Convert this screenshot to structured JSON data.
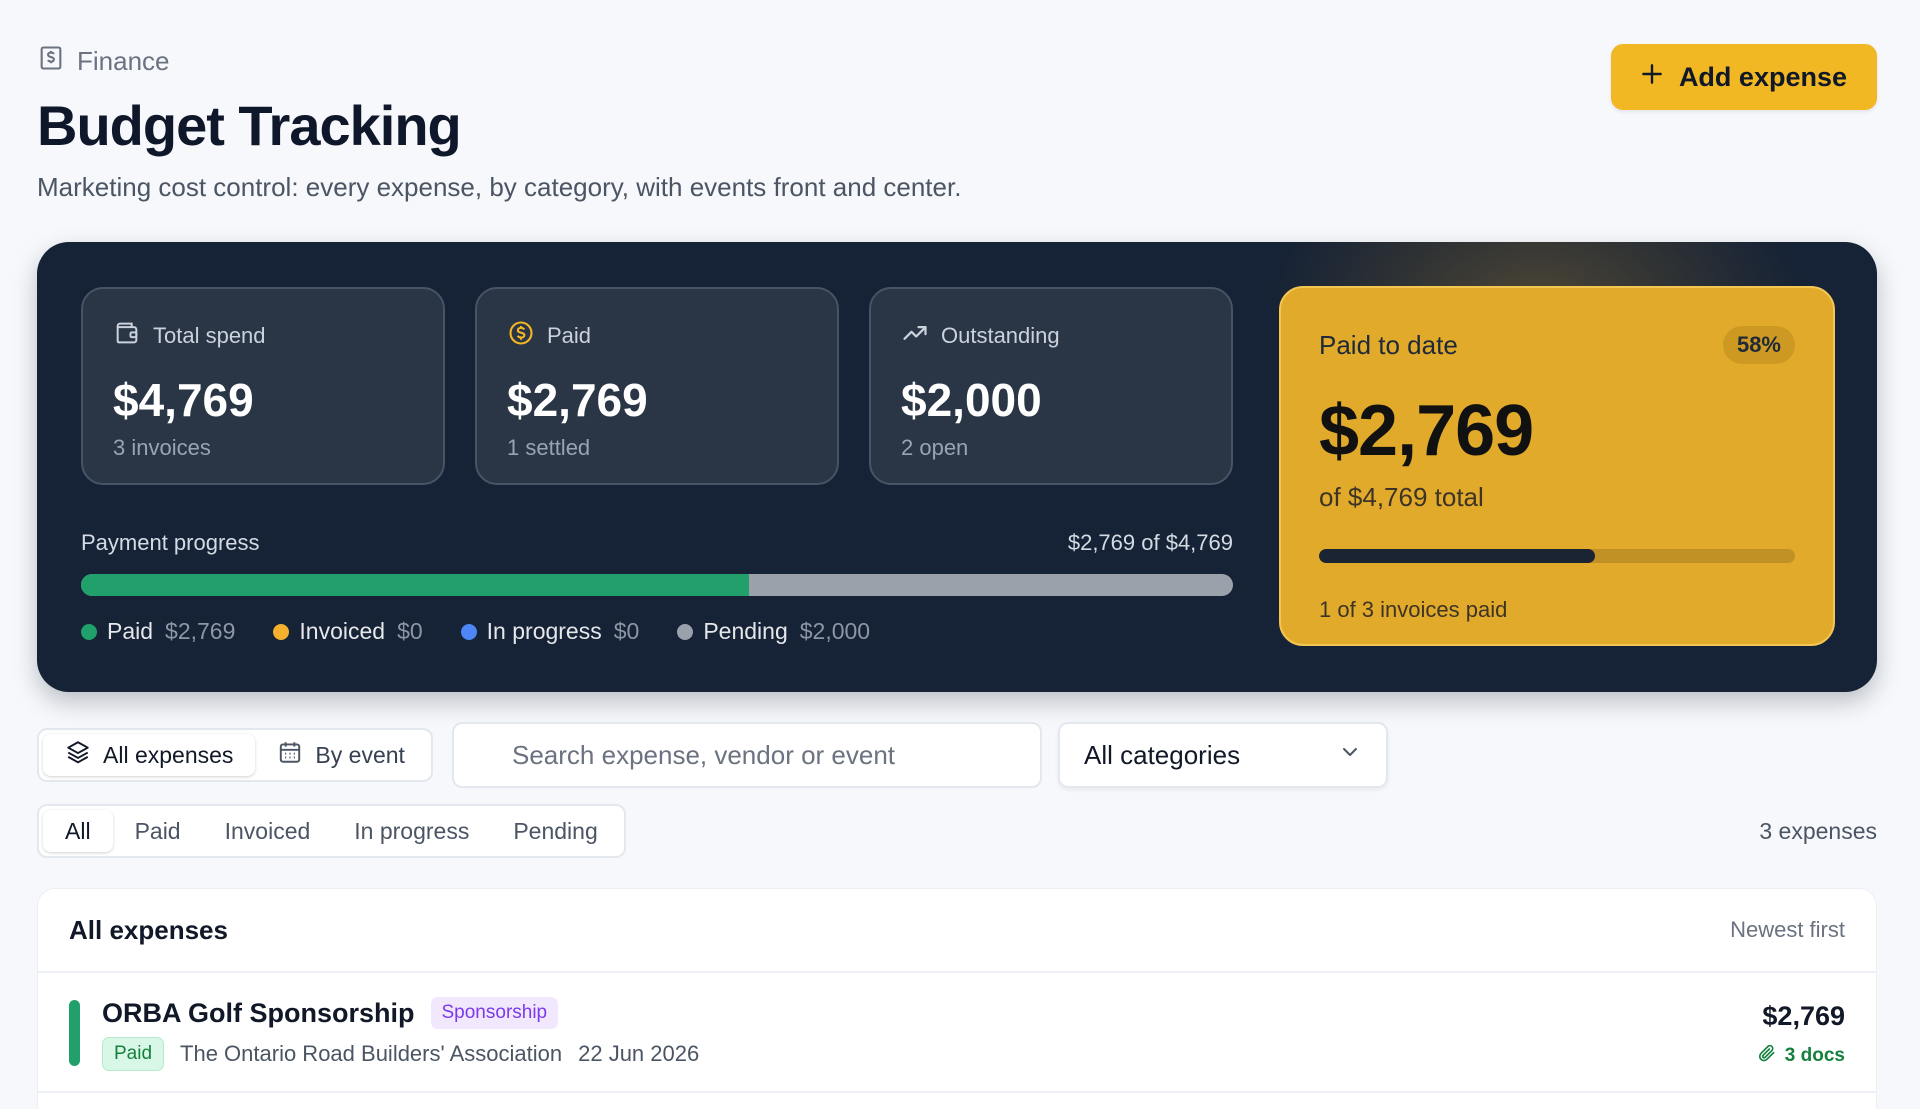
{
  "header": {
    "breadcrumb": "Finance",
    "title": "Budget Tracking",
    "subtitle": "Marketing cost control: every expense, by category, with events front and center.",
    "add_button": "Add expense"
  },
  "stats": [
    {
      "icon": "wallet-icon",
      "label": "Total spend",
      "value": "$4,769",
      "sub": "3 invoices"
    },
    {
      "icon": "dollar-coin-icon",
      "label": "Paid",
      "value": "$2,769",
      "sub": "1 settled"
    },
    {
      "icon": "trending-up-icon",
      "label": "Outstanding",
      "value": "$2,000",
      "sub": "2 open"
    }
  ],
  "progress": {
    "label": "Payment progress",
    "amount_text": "$2,769 of $4,769",
    "paid_fraction": 0.58,
    "legend": [
      {
        "label": "Paid",
        "value": "$2,769",
        "color": "#22a06b"
      },
      {
        "label": "Invoiced",
        "value": "$0",
        "color": "#f5b02e"
      },
      {
        "label": "In progress",
        "value": "$0",
        "color": "#4f86f7"
      },
      {
        "label": "Pending",
        "value": "$2,000",
        "color": "#9aa1ab"
      }
    ]
  },
  "paid_card": {
    "title": "Paid to date",
    "badge": "58%",
    "value": "$2,769",
    "of_total": "of $4,769 total",
    "fraction": 0.58,
    "note": "1 of 3 invoices paid"
  },
  "filters": {
    "view_tabs": [
      {
        "label": "All expenses",
        "icon": "layers-icon",
        "active": true
      },
      {
        "label": "By event",
        "icon": "calendar-icon",
        "active": false
      }
    ],
    "search_placeholder": "Search expense, vendor or event",
    "category_select": "All categories",
    "status_tabs": [
      "All",
      "Paid",
      "Invoiced",
      "In progress",
      "Pending"
    ],
    "active_status": "All",
    "count_text": "3 expenses"
  },
  "list": {
    "title": "All expenses",
    "sort": "Newest first",
    "rows": [
      {
        "name": "ORBA Golf Sponsorship",
        "category": "Sponsorship",
        "status": "Paid",
        "vendor": "The Ontario Road Builders' Association",
        "date": "22 Jun 2026",
        "amount": "$2,769",
        "docs": "3 docs"
      }
    ]
  }
}
